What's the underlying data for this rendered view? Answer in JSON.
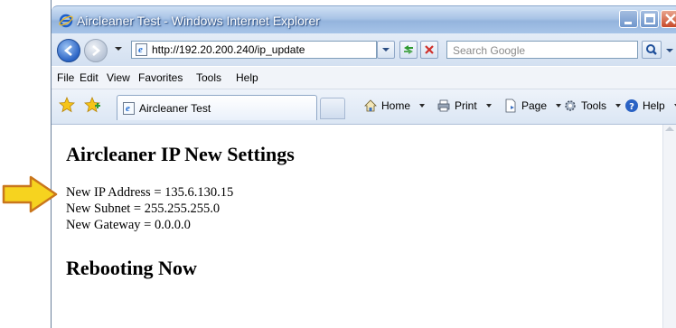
{
  "window": {
    "title": "Aircleaner Test - Windows Internet Explorer"
  },
  "address_bar": {
    "url": "http://192.20.200.240/ip_update",
    "search_placeholder": "Search Google"
  },
  "menu": {
    "items": [
      {
        "label": "File"
      },
      {
        "label": "Edit"
      },
      {
        "label": "View"
      },
      {
        "label": "Favorites"
      },
      {
        "label": "Tools"
      },
      {
        "label": "Help"
      }
    ]
  },
  "tab": {
    "label": "Aircleaner Test"
  },
  "command_bar": {
    "home": "Home",
    "print": "Print",
    "page": "Page",
    "tools": "Tools",
    "help": "Help"
  },
  "page": {
    "heading": "Aircleaner IP New Settings",
    "lines": [
      "New IP Address = 135.6.130.15",
      "New Subnet = 255.255.255.0",
      "New Gateway = 0.0.0.0"
    ],
    "status_heading": "Rebooting Now"
  },
  "colors": {
    "titlebar": "#a9c4e6",
    "arrow_fill": "#f6d31f",
    "arrow_stroke": "#c9761c"
  }
}
